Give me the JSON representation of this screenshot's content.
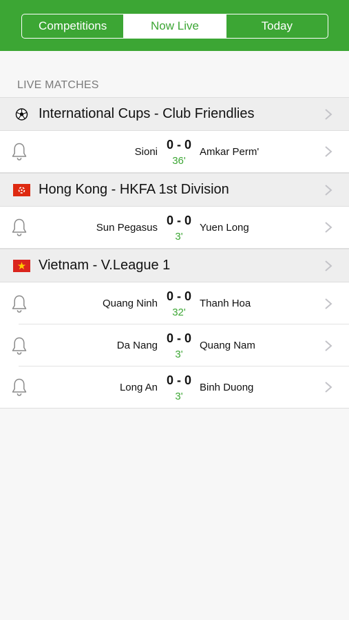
{
  "tabs": [
    {
      "label": "Competitions"
    },
    {
      "label": "Now Live"
    },
    {
      "label": "Today"
    }
  ],
  "section_label": "LIVE MATCHES",
  "groups": [
    {
      "title": "International Cups - Club Friendlies",
      "icon": "soccer-ball-icon",
      "matches": [
        {
          "home": "Sioni",
          "score": "0 - 0",
          "minute": "36'",
          "away": "Amkar Perm'"
        }
      ]
    },
    {
      "title": "Hong Kong - HKFA 1st Division",
      "icon": "hong-kong-flag-icon",
      "matches": [
        {
          "home": "Sun Pegasus",
          "score": "0 - 0",
          "minute": "3'",
          "away": "Yuen Long"
        }
      ]
    },
    {
      "title": "Vietnam - V.League 1",
      "icon": "vietnam-flag-icon",
      "matches": [
        {
          "home": "Quang Ninh",
          "score": "0 - 0",
          "minute": "32'",
          "away": "Thanh Hoa"
        },
        {
          "home": "Da Nang",
          "score": "0 - 0",
          "minute": "3'",
          "away": "Quang Nam"
        },
        {
          "home": "Long An",
          "score": "0 - 0",
          "minute": "3'",
          "away": "Binh Duong"
        }
      ]
    }
  ],
  "colors": {
    "accent": "#3ca634",
    "header_bg": "#eeeeee",
    "page_bg": "#f7f7f7"
  }
}
